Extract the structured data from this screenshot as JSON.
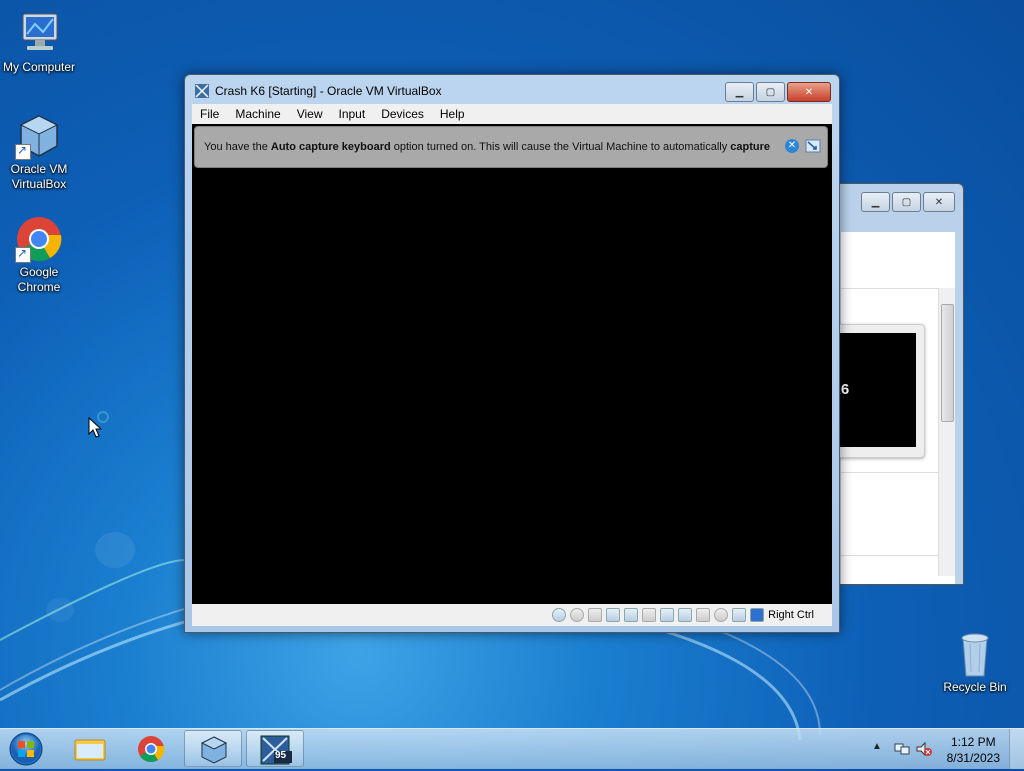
{
  "desktop": {
    "icons": [
      {
        "label": "My Computer"
      },
      {
        "label": "Oracle VM VirtualBox"
      },
      {
        "label": "Google Chrome"
      },
      {
        "label": "Recycle Bin"
      }
    ]
  },
  "vm_window": {
    "title": "Crash K6 [Starting] - Oracle VM VirtualBox",
    "menu": [
      "File",
      "Machine",
      "View",
      "Input",
      "Devices",
      "Help"
    ],
    "notice": {
      "text_1": "You have the ",
      "bold_1": "Auto capture keyboard",
      "text_2": " option turned on. This will cause the Virtual Machine to automatically ",
      "bold_2": "capture"
    },
    "host_key": "Right Ctrl"
  },
  "back_window": {
    "partial_label": "K6"
  },
  "taskbar": {
    "time": "1:12 PM",
    "date": "8/31/2023",
    "vm_badge": "95"
  },
  "colors": {
    "accent": "#2f86d8",
    "close_red": "#c7412a"
  }
}
